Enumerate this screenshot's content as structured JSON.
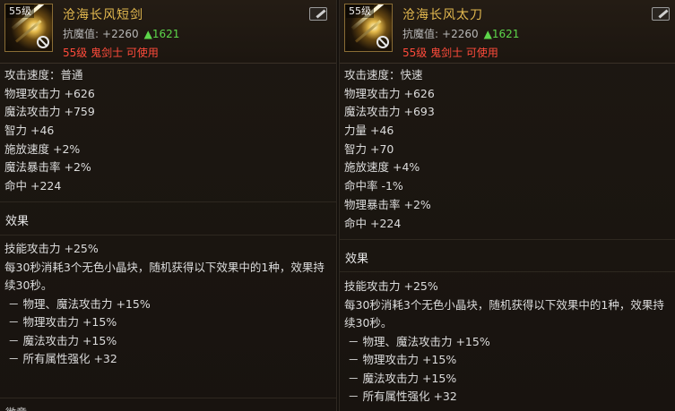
{
  "left": {
    "icon_level": "55级",
    "name": "沧海长风短剑",
    "resist_label": "抗魔值:",
    "resist_value": "+2260",
    "resist_up": "▲1621",
    "usable": "55级 鬼剑士 可使用",
    "stats": [
      "攻击速度：普通",
      "物理攻击力 +626",
      "魔法攻击力 +759",
      "智力 +46",
      "施放速度 +2%",
      "魔法暴击率 +2%",
      "命中 +224"
    ],
    "effect_title": "效果",
    "effects": [
      "技能攻击力 +25%",
      "每30秒消耗3个无色小晶块，随机获得以下效果中的1种，效果持续30秒。",
      "－ 物理、魔法攻击力 +15%",
      "－ 物理攻击力 +15%",
      "－ 魔法攻击力 +15%",
      "－ 所有属性强化 +32"
    ],
    "footer_fragment": "微章"
  },
  "right": {
    "icon_level": "55级",
    "name": "沧海长风太刀",
    "resist_label": "抗魔值:",
    "resist_value": "+2260",
    "resist_up": "▲1621",
    "usable": "55级 鬼剑士 可使用",
    "stats": [
      "攻击速度：快速",
      "物理攻击力 +626",
      "魔法攻击力 +693",
      "力量 +46",
      "智力 +70",
      "施放速度 +4%",
      "命中率 -1%",
      "物理暴击率 +2%",
      "命中 +224"
    ],
    "effect_title": "效果",
    "effects": [
      "技能攻击力 +25%",
      "每30秒消耗3个无色小晶块，随机获得以下效果中的1种，效果持续30秒。",
      "－ 物理、魔法攻击力 +15%",
      "－ 物理攻击力 +15%",
      "－ 魔法攻击力 +15%",
      "－ 所有属性强化 +32"
    ]
  },
  "colors": {
    "name": "#e2b84f",
    "usable": "#ff4b3b",
    "increase": "#5dd64a",
    "text": "#dcdcdc"
  },
  "icons": {
    "item": "sword-icon",
    "unusable": "no-entry-icon",
    "edit": "edit-icon"
  }
}
